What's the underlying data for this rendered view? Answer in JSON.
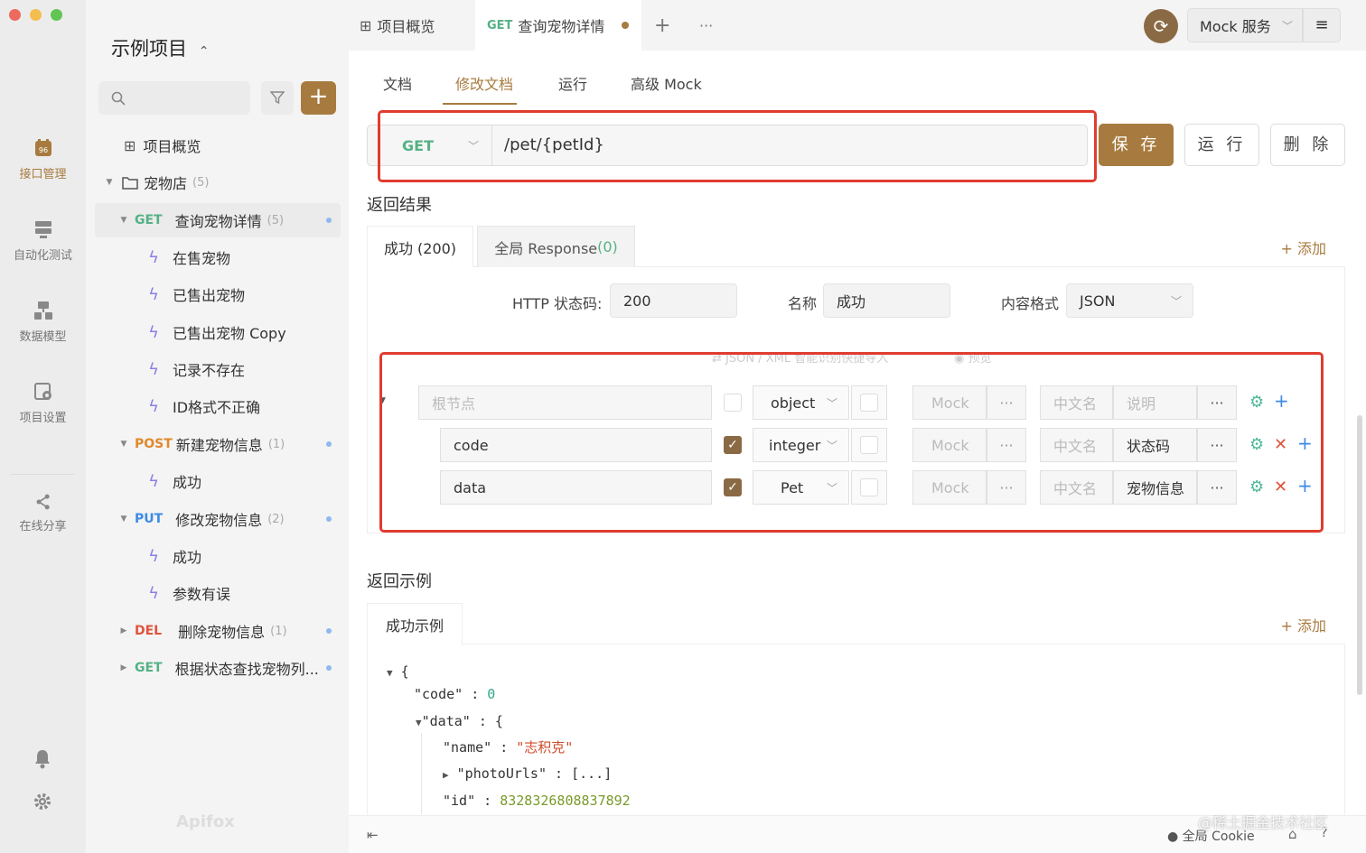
{
  "window": {
    "traffic_colors": [
      "#ec6a5e",
      "#f4be4f",
      "#61c554"
    ]
  },
  "rail": {
    "items": [
      {
        "label": "接口管理",
        "icon": "api-icon",
        "active": true
      },
      {
        "label": "自动化测试",
        "icon": "test-icon",
        "active": false
      },
      {
        "label": "数据模型",
        "icon": "model-icon",
        "active": false
      },
      {
        "label": "项目设置",
        "icon": "settings-icon",
        "active": false
      },
      {
        "label": "在线分享",
        "icon": "share-icon",
        "active": false
      }
    ],
    "bottom_icons": [
      "bell-icon",
      "gear-icon"
    ]
  },
  "sidebar": {
    "project_title": "示例项目",
    "search_placeholder": "",
    "brand": "Apifox",
    "tree": [
      {
        "type": "overview",
        "label": "项目概览"
      },
      {
        "type": "folder",
        "label": "宠物店",
        "count": "(5)"
      },
      {
        "type": "api",
        "method": "GET",
        "label": "查询宠物详情",
        "count": "(5)",
        "active": true
      },
      {
        "type": "case",
        "label": "在售宠物"
      },
      {
        "type": "case",
        "label": "已售出宠物"
      },
      {
        "type": "case",
        "label": "已售出宠物 Copy"
      },
      {
        "type": "case",
        "label": "记录不存在"
      },
      {
        "type": "case",
        "label": "ID格式不正确"
      },
      {
        "type": "api",
        "method": "POST",
        "label": "新建宠物信息",
        "count": "(1)"
      },
      {
        "type": "case",
        "label": "成功"
      },
      {
        "type": "api",
        "method": "PUT",
        "label": "修改宠物信息",
        "count": "(2)"
      },
      {
        "type": "case",
        "label": "成功"
      },
      {
        "type": "case",
        "label": "参数有误"
      },
      {
        "type": "api",
        "method": "DEL",
        "label": "删除宠物信息",
        "count": "(1)"
      },
      {
        "type": "api",
        "method": "GET",
        "label": "根据状态查找宠物列..."
      }
    ]
  },
  "topbar": {
    "tabs": [
      {
        "label": "项目概览",
        "method": ""
      },
      {
        "label": "查询宠物详情",
        "method": "GET"
      }
    ],
    "new_tab": "+",
    "more": "···",
    "mock_service": "Mock 服务"
  },
  "subtabs": [
    "文档",
    "修改文档",
    "运行",
    "高级 Mock"
  ],
  "request": {
    "method": "GET",
    "path": "/pet/{petId}"
  },
  "actions": {
    "save": "保 存",
    "run": "运 行",
    "delete": "删 除"
  },
  "response": {
    "section_title": "返回结果",
    "tabs": [
      "成功 (200)",
      "全局 Response"
    ],
    "global_count": "(0)",
    "add": "+ 添加",
    "status_label": "HTTP 状态码:",
    "status_value": "200",
    "name_label": "名称",
    "name_value": "成功",
    "format_label": "内容格式",
    "format_value": "JSON",
    "import_hint": "JSON / XML 智能识别快捷导入",
    "preview_hint": "预览",
    "schema_rows": [
      {
        "name": "",
        "name_placeholder": "根节点",
        "required": false,
        "type": "object",
        "mock": "Mock",
        "zh": "中文名",
        "desc": "",
        "desc_placeholder": "说明"
      },
      {
        "name": "code",
        "required": true,
        "type": "integer",
        "mock": "Mock",
        "zh": "中文名",
        "desc": "状态码"
      },
      {
        "name": "data",
        "required": true,
        "type": "Pet",
        "mock": "Mock",
        "zh": "中文名",
        "desc": "宠物信息"
      }
    ]
  },
  "example": {
    "section_title": "返回示例",
    "tab": "成功示例",
    "add": "+ 添加",
    "lines": {
      "open": "{",
      "code_key": "\"code\"",
      "code_val": "0",
      "data_key": "\"data\"",
      "data_open": "{",
      "name_key": "\"name\"",
      "name_val": "\"志积克\"",
      "photo_key": "\"photoUrls\"",
      "photo_val": "[...]",
      "id_key": "\"id\"",
      "id_val": "8328326808837892"
    }
  },
  "statusbar": {
    "cookie": "全局 Cookie",
    "watermark": "@稀土掘金技术社区"
  },
  "colors": {
    "accent": "#a77b3f",
    "get": "#55b185",
    "post": "#e0892c",
    "put": "#3c8be5",
    "del": "#e0533d",
    "highlight": "#e03c30"
  }
}
